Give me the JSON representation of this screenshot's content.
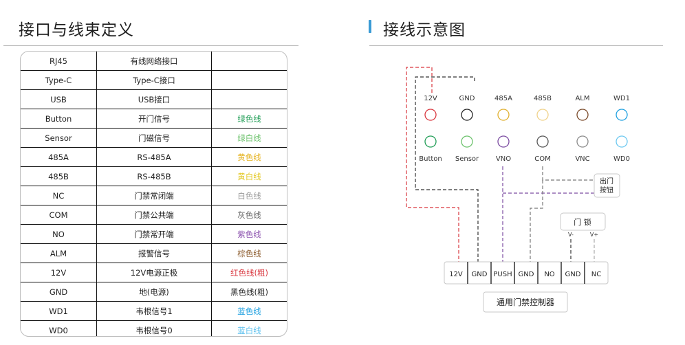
{
  "left_section": {
    "title": "接口与线束定义",
    "rows": [
      {
        "port": "RJ45",
        "desc": "有线网络接口",
        "wire": "",
        "wire_color": "#333333"
      },
      {
        "port": "Type-C",
        "desc": "Type-C接口",
        "wire": "",
        "wire_color": "#333333"
      },
      {
        "port": "USB",
        "desc": "USB接口",
        "wire": "",
        "wire_color": "#333333"
      },
      {
        "port": "Button",
        "desc": "开门信号",
        "wire": "绿色线",
        "wire_color": "#1f9d55"
      },
      {
        "port": "Sensor",
        "desc": "门磁信号",
        "wire": "绿白线",
        "wire_color": "#6cc26c"
      },
      {
        "port": "485A",
        "desc": "RS-485A",
        "wire": "黄色线",
        "wire_color": "#e6b422"
      },
      {
        "port": "485B",
        "desc": "RS-485B",
        "wire": "黄白线",
        "wire_color": "#e3c824"
      },
      {
        "port": "NC",
        "desc": "门禁常闭端",
        "wire": "白色线",
        "wire_color": "#9a9a9a"
      },
      {
        "port": "COM",
        "desc": "门禁公共端",
        "wire": "灰色线",
        "wire_color": "#666666"
      },
      {
        "port": "NO",
        "desc": "门禁常开端",
        "wire": "紫色线",
        "wire_color": "#8e55b0"
      },
      {
        "port": "ALM",
        "desc": "报警信号",
        "wire": "棕色线",
        "wire_color": "#8b5a2b"
      },
      {
        "port": "12V",
        "desc": "12V电源正极",
        "wire": "红色线(粗)",
        "wire_color": "#d9363e"
      },
      {
        "port": "GND",
        "desc": "地(电源)",
        "wire": "黑色线(粗)",
        "wire_color": "#222222"
      },
      {
        "port": "WD1",
        "desc": "韦根信号1",
        "wire": "蓝色线",
        "wire_color": "#1ea0e0"
      },
      {
        "port": "WD0",
        "desc": "韦根信号0",
        "wire": "蓝白线",
        "wire_color": "#5cc0ee"
      }
    ]
  },
  "right_section": {
    "title": "接线示意图",
    "accent_color": "#3a9bd5",
    "top_terminals": [
      {
        "label": "12V",
        "color": "#d9363e"
      },
      {
        "label": "GND",
        "color": "#222222"
      },
      {
        "label": "485A",
        "color": "#e0b030"
      },
      {
        "label": "485B",
        "color": "#f0d28a"
      },
      {
        "label": "ALM",
        "color": "#7a4a2a"
      },
      {
        "label": "WD1",
        "color": "#1ea0e0"
      }
    ],
    "bottom_terminals": [
      {
        "label": "Button",
        "color": "#1f9d55"
      },
      {
        "label": "Sensor",
        "color": "#6cc26c"
      },
      {
        "label": "VNO",
        "color": "#7a4aa0"
      },
      {
        "label": "COM",
        "color": "#555555"
      },
      {
        "label": "VNC",
        "color": "#8a8a8a"
      },
      {
        "label": "WD0",
        "color": "#6cc8f0"
      }
    ],
    "exit_button": {
      "line1": "出门",
      "line2": "按钮"
    },
    "door_lock": {
      "label": "门 锁",
      "pin_minus": "V-",
      "pin_plus": "V+"
    },
    "controller_terminals": [
      "12V",
      "GND",
      "PUSH",
      "GND",
      "NO",
      "GND",
      "NC"
    ],
    "controller_label": "通用门禁控制器",
    "wire_colors": {
      "red": "#d9363e",
      "black": "#333333",
      "purple": "#7a4aa0",
      "gray": "#777777",
      "lightgray": "#aaaaaa"
    }
  }
}
